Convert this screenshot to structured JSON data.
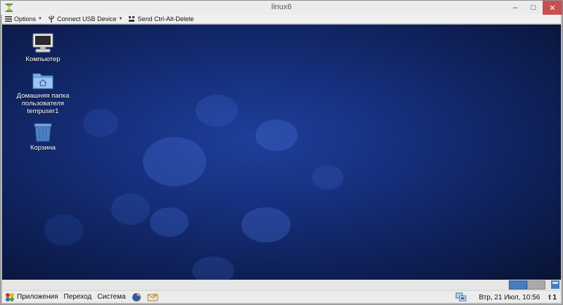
{
  "window": {
    "title": "linux6",
    "app_icon": "hourglass-icon",
    "controls": {
      "minimize": "–",
      "maximize": "□",
      "close": "✕"
    }
  },
  "toolbar": {
    "options_label": "Options",
    "usb_label": "Connect USB Device",
    "cad_label": "Send Ctrl-Alt-Delete"
  },
  "desktop": {
    "icons": [
      {
        "label": "Компьютер",
        "icon": "computer-icon"
      },
      {
        "label": "Домашняя папка пользователя tempuser1",
        "icon": "home-folder-icon"
      },
      {
        "label": "Корзина",
        "icon": "trash-icon"
      }
    ]
  },
  "panel": {
    "apps_label": "Приложения",
    "places_label": "Переход",
    "system_label": "Система",
    "clock": "Втр, 21 Июл, 10:56",
    "workspace_label": "t 1"
  },
  "colors": {
    "desktop_center": "#1d3f9a",
    "desktop_edge": "#081333",
    "close_button": "#c75050",
    "workspace_active": "#4a7dbf"
  }
}
